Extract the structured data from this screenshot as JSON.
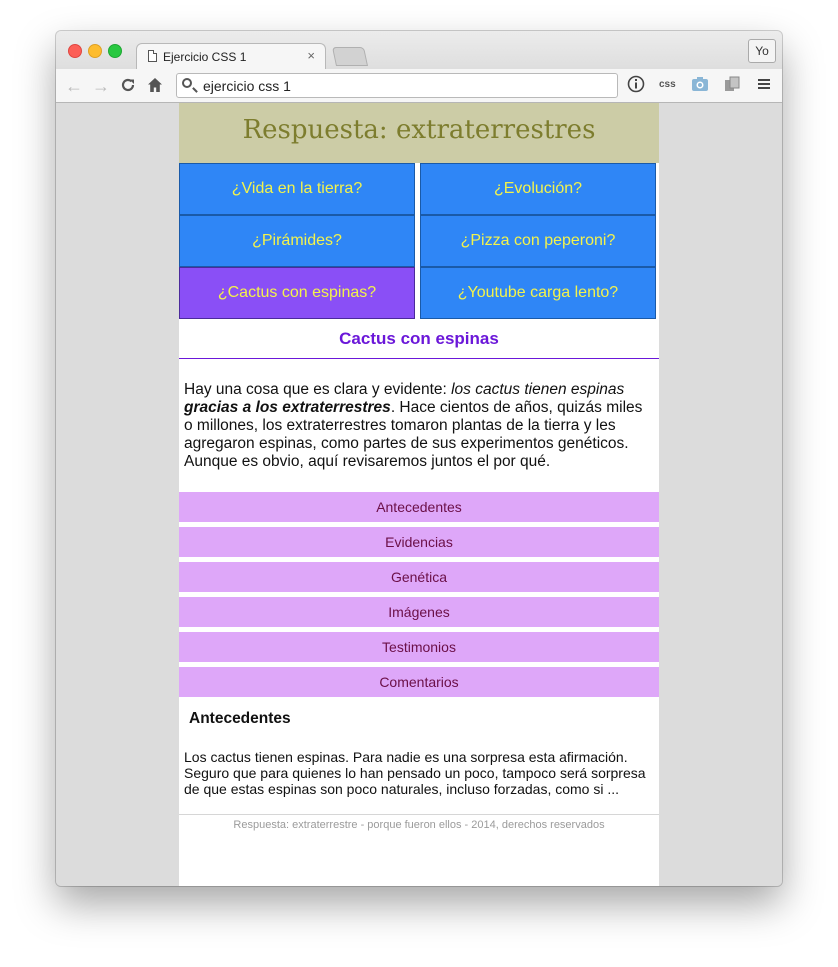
{
  "browser": {
    "tab_title": "Ejercicio CSS 1",
    "tab_close": "×",
    "profile_label": "Yo",
    "address": "ejercicio css 1",
    "css_ext_label": "css",
    "icons": [
      "back-arrow-icon",
      "forward-arrow-icon",
      "reload-icon",
      "home-icon",
      "search-icon",
      "info-icon",
      "css-extension-icon",
      "camera-icon",
      "extension-icon",
      "menu-icon"
    ]
  },
  "page": {
    "title": "Respuesta: extraterrestres",
    "questions": [
      {
        "label": "¿Vida en la tierra?"
      },
      {
        "label": "¿Evolución?"
      },
      {
        "label": "¿Pirámides?"
      },
      {
        "label": "¿Pizza con peperoni?"
      },
      {
        "label": "¿Cactus con espinas?",
        "active": true
      },
      {
        "label": "¿Youtube carga lento?"
      }
    ],
    "section_title": "Cactus con espinas",
    "intro": {
      "text1": "Hay una cosa que es clara y evidente: ",
      "em": "los cactus tienen espinas",
      "strong_em": "gracias a los extraterrestres",
      "text2": ". Hace cientos de años, quizás miles o millones, los extraterrestres tomaron plantas de la tierra y les agregaron espinas, como partes de sus experimentos genéticos. Aunque es obvio, aquí revisaremos juntos el por qué."
    },
    "menu": [
      "Antecedentes",
      "Evidencias",
      "Genética",
      "Imágenes",
      "Testimonios",
      "Comentarios"
    ],
    "sub_title": "Antecedentes",
    "paragraph": "Los cactus tienen espinas. Para nadie es una sorpresa esta afirmación. Seguro que para quienes lo han pensado un poco, tampoco será sorpresa de que estas espinas son poco naturales, incluso forzadas, como si ...",
    "footer": "Respuesta: extraterrestre - porque fueron ellos - 2014, derechos reservados"
  },
  "colors": {
    "header_bg": "#cccca6",
    "header_text": "#7d7d2e",
    "question_bg": "#2f86f6",
    "question_active_bg": "#8a4ff6",
    "question_text": "#f3f34c",
    "section_title": "#6b17d9",
    "menu_bg": "#dea7f9",
    "menu_text": "#6b0f47"
  }
}
